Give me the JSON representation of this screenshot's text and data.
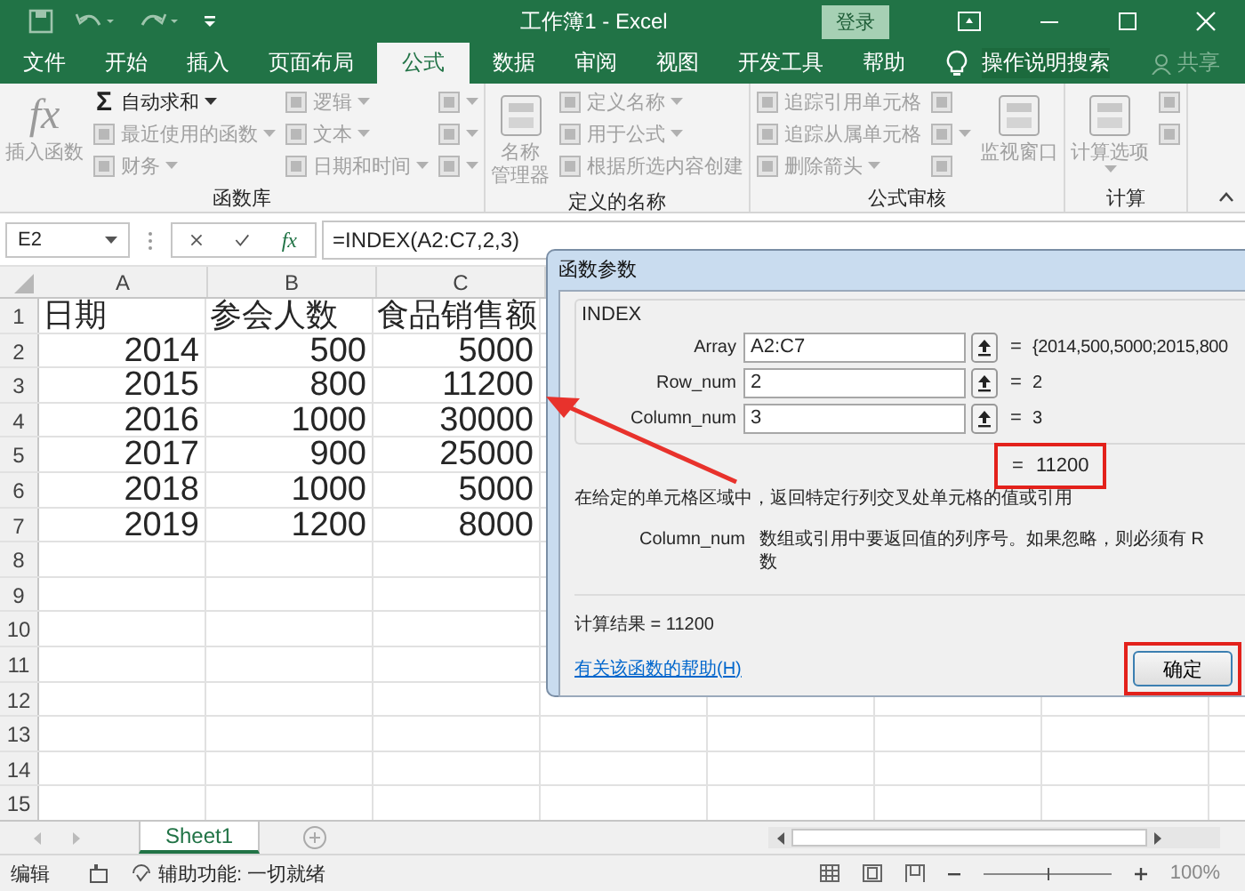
{
  "title_bar": {
    "title": "工作簿1  -  Excel",
    "sign_in": "登录"
  },
  "tabs": [
    {
      "label": "文件",
      "selected": false
    },
    {
      "label": "开始",
      "selected": false
    },
    {
      "label": "插入",
      "selected": false
    },
    {
      "label": "页面布局",
      "selected": false
    },
    {
      "label": "公式",
      "selected": true
    },
    {
      "label": "数据",
      "selected": false
    },
    {
      "label": "审阅",
      "selected": false
    },
    {
      "label": "视图",
      "selected": false
    },
    {
      "label": "开发工具",
      "selected": false
    },
    {
      "label": "帮助",
      "selected": false
    }
  ],
  "tell_me": "操作说明搜索",
  "share": "共享",
  "ribbon": [
    {
      "label": "函数库",
      "large": [
        {
          "glyph": "fx",
          "lines": [
            "插入函数"
          ],
          "disabled": true,
          "dropdown": false
        }
      ],
      "columns": [
        [
          {
            "glyph": "Σ",
            "label": "自动求和",
            "disabled": false,
            "dropdown": true
          },
          {
            "label": "最近使用的函数",
            "disabled": true,
            "dropdown": true
          },
          {
            "label": "财务",
            "disabled": true,
            "dropdown": true
          }
        ],
        [
          {
            "label": "逻辑",
            "disabled": true,
            "dropdown": true
          },
          {
            "label": "文本",
            "disabled": true,
            "dropdown": true
          },
          {
            "label": "日期和时间",
            "disabled": true,
            "dropdown": true
          }
        ],
        [
          {
            "disabled": true,
            "dropdown": true
          },
          {
            "disabled": true,
            "dropdown": true
          },
          {
            "disabled": true,
            "dropdown": true
          }
        ]
      ]
    },
    {
      "label": "定义的名称",
      "large": [
        {
          "lines": [
            "名称",
            "管理器"
          ],
          "disabled": true,
          "dropdown": false
        }
      ],
      "columns": [
        [
          {
            "label": "定义名称",
            "disabled": true,
            "dropdown": true
          },
          {
            "label": "用于公式",
            "disabled": true,
            "dropdown": true
          },
          {
            "label": "根据所选内容创建",
            "disabled": true,
            "dropdown": false
          }
        ]
      ]
    },
    {
      "label": "公式审核",
      "columns": [
        [
          {
            "label": "追踪引用单元格",
            "disabled": true,
            "dropdown": false
          },
          {
            "label": "追踪从属单元格",
            "disabled": true,
            "dropdown": false
          },
          {
            "label": "删除箭头",
            "disabled": true,
            "dropdown": true
          }
        ],
        [
          {
            "disabled": true,
            "dropdown": false
          },
          {
            "disabled": true,
            "dropdown": true
          },
          {
            "disabled": true,
            "dropdown": false
          }
        ]
      ],
      "large_after": [
        {
          "lines": [
            "监视窗口"
          ],
          "disabled": true,
          "dropdown": false
        }
      ]
    },
    {
      "label": "计算",
      "large": [
        {
          "lines": [
            "计算选项"
          ],
          "disabled": true,
          "dropdown": true
        }
      ],
      "columns": [
        [
          {
            "disabled": true,
            "dropdown": false
          },
          {
            "disabled": true,
            "dropdown": false
          }
        ]
      ]
    }
  ],
  "formula_bar": {
    "name_box": "E2",
    "insert_function": "fx",
    "formula": "=INDEX(A2:C7,2,3)"
  },
  "sheet": {
    "columns": [
      "A",
      "B",
      "C"
    ],
    "rows": [
      {
        "number": "1",
        "kind": "header",
        "cells": [
          "日期",
          "参会人数",
          "食品销售额"
        ]
      },
      {
        "number": "2",
        "kind": "data",
        "cells": [
          "2014",
          "500",
          "5000"
        ]
      },
      {
        "number": "3",
        "kind": "data",
        "cells": [
          "2015",
          "800",
          "11200"
        ]
      },
      {
        "number": "4",
        "kind": "data",
        "cells": [
          "2016",
          "1000",
          "30000"
        ]
      },
      {
        "number": "5",
        "kind": "data",
        "cells": [
          "2017",
          "900",
          "25000"
        ]
      },
      {
        "number": "6",
        "kind": "data",
        "cells": [
          "2018",
          "1000",
          "5000"
        ]
      },
      {
        "number": "7",
        "kind": "data",
        "cells": [
          "2019",
          "1200",
          "8000"
        ]
      },
      {
        "number": "8",
        "kind": "blank",
        "cells": []
      },
      {
        "number": "9",
        "kind": "blank",
        "cells": []
      },
      {
        "number": "10",
        "kind": "blank",
        "cells": []
      },
      {
        "number": "11",
        "kind": "blank",
        "cells": []
      },
      {
        "number": "12",
        "kind": "blank",
        "cells": []
      },
      {
        "number": "13",
        "kind": "blank",
        "cells": []
      },
      {
        "number": "14",
        "kind": "blank",
        "cells": []
      },
      {
        "number": "15",
        "kind": "blank",
        "cells": []
      }
    ]
  },
  "sheet_tabs": [
    {
      "label": "Sheet1",
      "selected": true
    }
  ],
  "status_bar": {
    "mode": "编辑",
    "accessibility": "辅助功能: 一切就绪",
    "zoom": {
      "level": 0.5,
      "reading": "100%"
    }
  },
  "dialog": {
    "title": "函数参数",
    "function": "INDEX",
    "args": [
      {
        "name": "Array",
        "value": "A2:C7",
        "sign": "=",
        "result": "{2014,500,5000;2015,800"
      },
      {
        "name": "Row_num",
        "value": "2",
        "sign": "=",
        "result": "2"
      },
      {
        "name": "Column_num",
        "value": "3",
        "sign": "=",
        "result": "3"
      }
    ],
    "result": {
      "sign": "=",
      "value": "11200",
      "highlighted": true
    },
    "description": "在给定的单元格区域中，返回特定行列交叉处单元格的值或引用",
    "param_name": "Column_num",
    "param_description": [
      "数组或引用中要返回值的列序号。如果忽略，则必须有 R",
      "数"
    ],
    "formula_result": "计算结果 =   11200",
    "help_link": "有关该函数的帮助(H)",
    "ok_button": {
      "label": "确定",
      "highlighted": true
    }
  },
  "annotation_arrow": {
    "shown": true
  }
}
